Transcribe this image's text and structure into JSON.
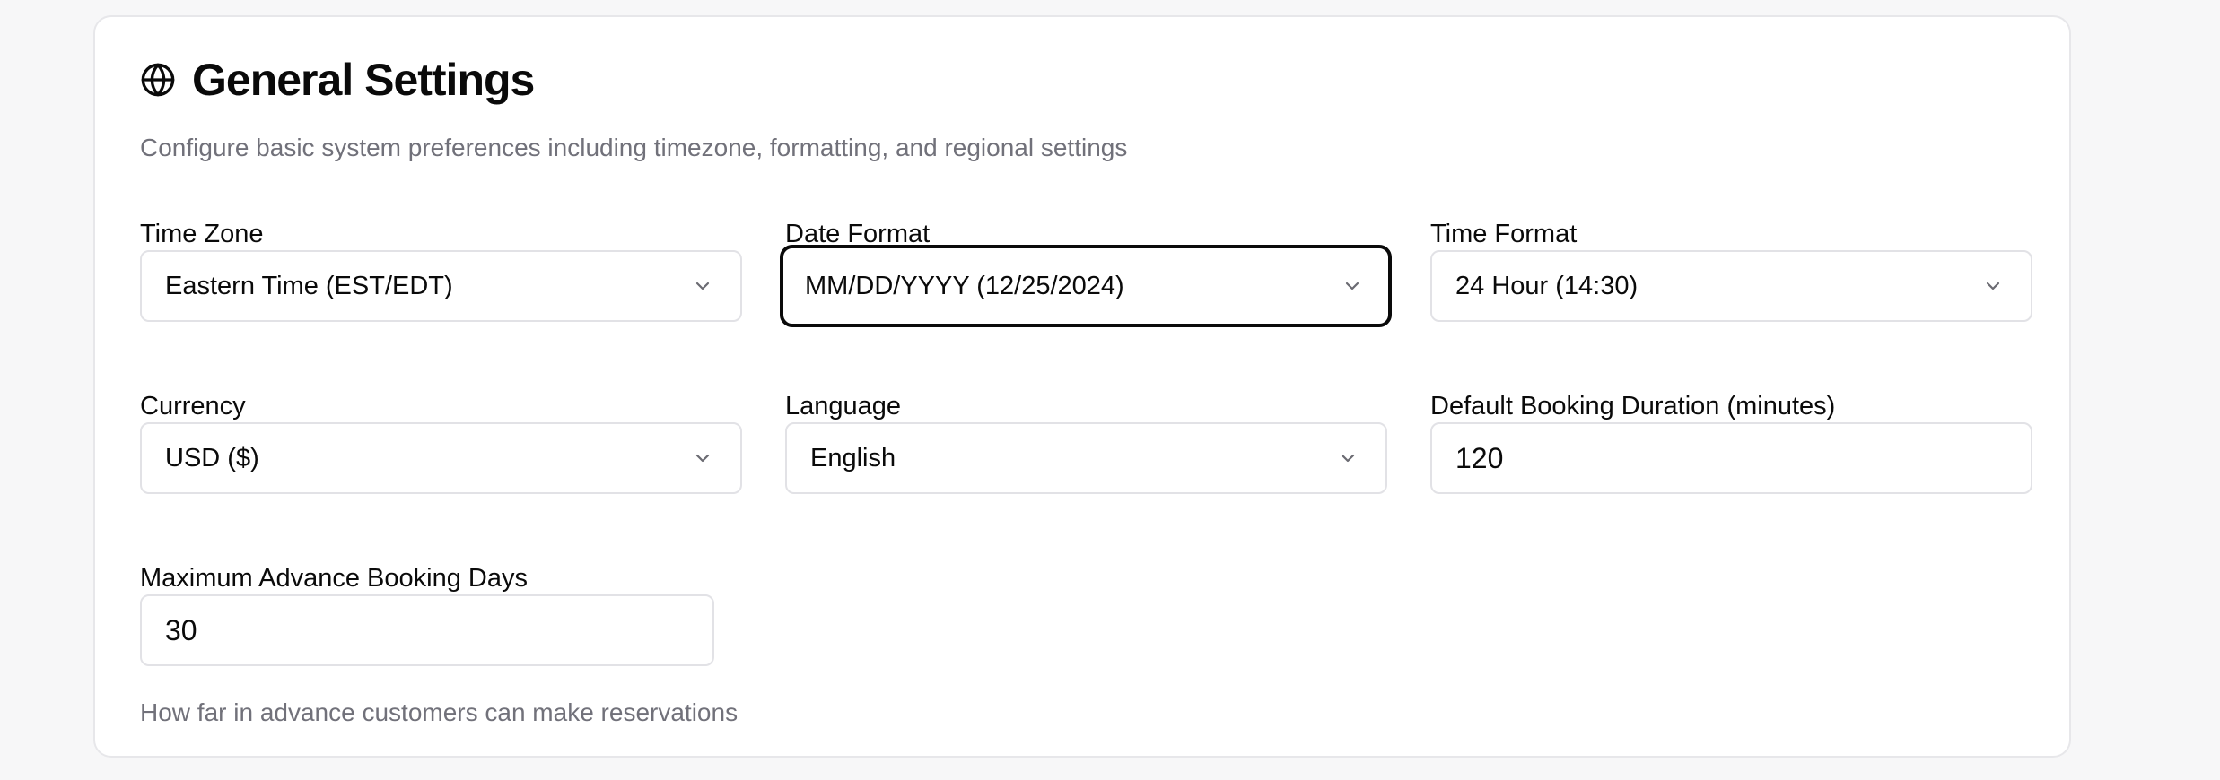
{
  "section": {
    "icon": "globe-icon",
    "title": "General Settings",
    "subtitle": "Configure basic system preferences including timezone, formatting, and regional settings"
  },
  "fields": {
    "time_zone": {
      "label": "Time Zone",
      "value": "Eastern Time (EST/EDT)"
    },
    "date_format": {
      "label": "Date Format",
      "value": "MM/DD/YYYY (12/25/2024)"
    },
    "time_format": {
      "label": "Time Format",
      "value": "24 Hour (14:30)"
    },
    "currency": {
      "label": "Currency",
      "value": "USD ($)"
    },
    "language": {
      "label": "Language",
      "value": "English"
    },
    "default_booking_duration": {
      "label": "Default Booking Duration (minutes)",
      "value": "120"
    },
    "max_advance_booking_days": {
      "label": "Maximum Advance Booking Days",
      "value": "30",
      "helper": "How far in advance customers can make reservations"
    }
  },
  "colors": {
    "text": "#0a0a0a",
    "muted": "#71717a",
    "border": "#e2e2e6",
    "focus_ring": "#0a0a0a",
    "background": "#f7f7f8"
  }
}
